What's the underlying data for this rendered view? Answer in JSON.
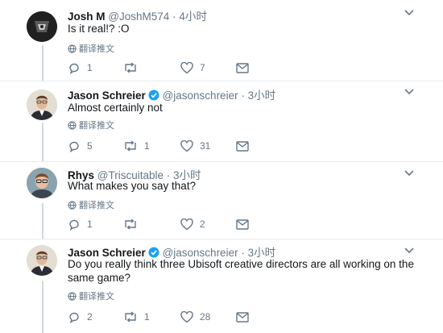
{
  "colors": {
    "retweet": "#17bf63",
    "verified": "#1da1f2",
    "muted": "#657786"
  },
  "ui": {
    "translate_label": "翻译推文"
  },
  "tweets": [
    {
      "name": "Josh M",
      "handle": "@JoshM574",
      "time": "4小时",
      "text": "Is it real!? :O",
      "verified": false,
      "avatar": "dark-sports-logo",
      "reply_count": "1",
      "retweet_count": "",
      "like_count": "7"
    },
    {
      "name": "Jason Schreier",
      "handle": "@jasonschreier",
      "time": "3小时",
      "text": "Almost certainly not",
      "verified": true,
      "avatar": "man-with-glasses",
      "reply_count": "5",
      "retweet_count": "1",
      "like_count": "31"
    },
    {
      "name": "Rhys",
      "handle": "@Triscuitable",
      "time": "3小时",
      "text": "What makes you say that?",
      "verified": false,
      "avatar": "young-man-glasses",
      "reply_count": "1",
      "retweet_count": "",
      "like_count": "2"
    },
    {
      "name": "Jason Schreier",
      "handle": "@jasonschreier",
      "time": "3小时",
      "text": "Do you really think three Ubisoft creative directors are all working on the same game?",
      "verified": true,
      "avatar": "man-with-glasses",
      "reply_count": "2",
      "retweet_count": "1",
      "like_count": "28"
    }
  ]
}
